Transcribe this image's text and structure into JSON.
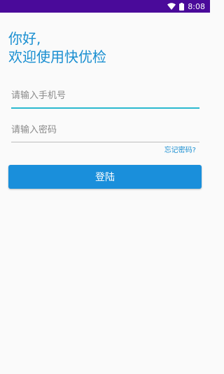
{
  "status_bar": {
    "time": "8:08",
    "wifi_icon": "wifi-icon",
    "battery_icon": "battery-icon",
    "background": "#4a0a9a"
  },
  "greeting": {
    "line1": "你好,",
    "line2": "欢迎使用快优检"
  },
  "form": {
    "phone_placeholder": "请输入手机号",
    "password_placeholder": "请输入密码",
    "forgot_password": "忘记密码?",
    "login_button": "登陆"
  },
  "colors": {
    "accent": "#1a8fdb",
    "focus_underline": "#2bb9cf"
  }
}
